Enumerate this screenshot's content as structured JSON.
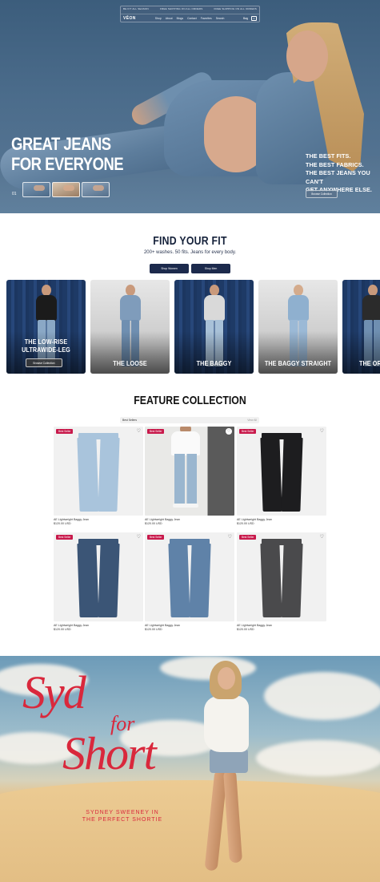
{
  "header": {
    "promo_left": "BE FIT ALL SEASON",
    "promo_center": "FREE SHIPPING ON ALL ORDERS",
    "promo_right": "FREE SHIPPING ON ALL ORDERS",
    "logo": "VĒON",
    "nav": [
      "Shop",
      "About",
      "Blogs",
      "Contact",
      "Favorites",
      "Search"
    ],
    "bag_label": "Bag",
    "bag_count": "0"
  },
  "hero": {
    "title_line1": "GREAT JEANS",
    "title_line2": "FOR EVERYONE",
    "points": [
      "THE BEST FITS.",
      "THE BEST FABRICS.",
      "THE BEST JEANS YOU CAN'T",
      "GET ANYWHERE ELSE."
    ],
    "cta": "Browse Collection",
    "slide_number": "01"
  },
  "fit": {
    "title": "FIND YOUR FIT",
    "subtitle": "200+ washes. 50 fits. Jeans for every body.",
    "btn_women": "Shop Women",
    "btn_men": "Shop Men",
    "cards": [
      {
        "line1": "THE LOW-RISE",
        "line2": "ULTRAWIDE-LEG",
        "cta": "Browse Collection"
      },
      {
        "line1": "THE LOOSE",
        "line2": ""
      },
      {
        "line1": "THE BAGGY",
        "line2": ""
      },
      {
        "line1": "THE BAGGY STRAIGHT",
        "line2": ""
      },
      {
        "line1": "THE ORIGIN",
        "line2": ""
      }
    ]
  },
  "feature": {
    "title": "FEATURE COLLECTION",
    "filter_label": "Best Sellers",
    "view_all": "View All",
    "products": [
      {
        "badge": "Best Seller",
        "name": "AE Lightweight Baggy Jean",
        "price": "$120.00 USD",
        "wash": "#a9c4dc"
      },
      {
        "badge": "Best Seller",
        "name": "AE Lightweight Baggy Jean",
        "price": "$120.00 USD",
        "wash": "#9ab6cf"
      },
      {
        "badge": "Best Seller",
        "name": "AE Lightweight Baggy Jean",
        "price": "$120.00 USD",
        "wash": "#1d1d1f"
      },
      {
        "badge": "Best Seller",
        "name": "AE Lightweight Baggy Jean",
        "price": "$120.00 USD",
        "wash": "#3b5576"
      },
      {
        "badge": "Best Seller",
        "name": "AE Lightweight Baggy Jean",
        "price": "$120.00 USD",
        "wash": "#5f82a8"
      },
      {
        "badge": "Best Seller",
        "name": "AE Lightweight Baggy Jean",
        "price": "$120.00 USD",
        "wash": "#4a4a4c"
      }
    ]
  },
  "campaign": {
    "title_syd": "Syd",
    "title_for": "for",
    "title_short": "Short",
    "subtitle_line1": "SYDNEY SWEENEY IN",
    "subtitle_line2": "THE PERFECT SHORTIE"
  },
  "colors": {
    "accent_red": "#d9283c",
    "badge_red": "#c8194b",
    "navy": "#1c2a4c"
  }
}
